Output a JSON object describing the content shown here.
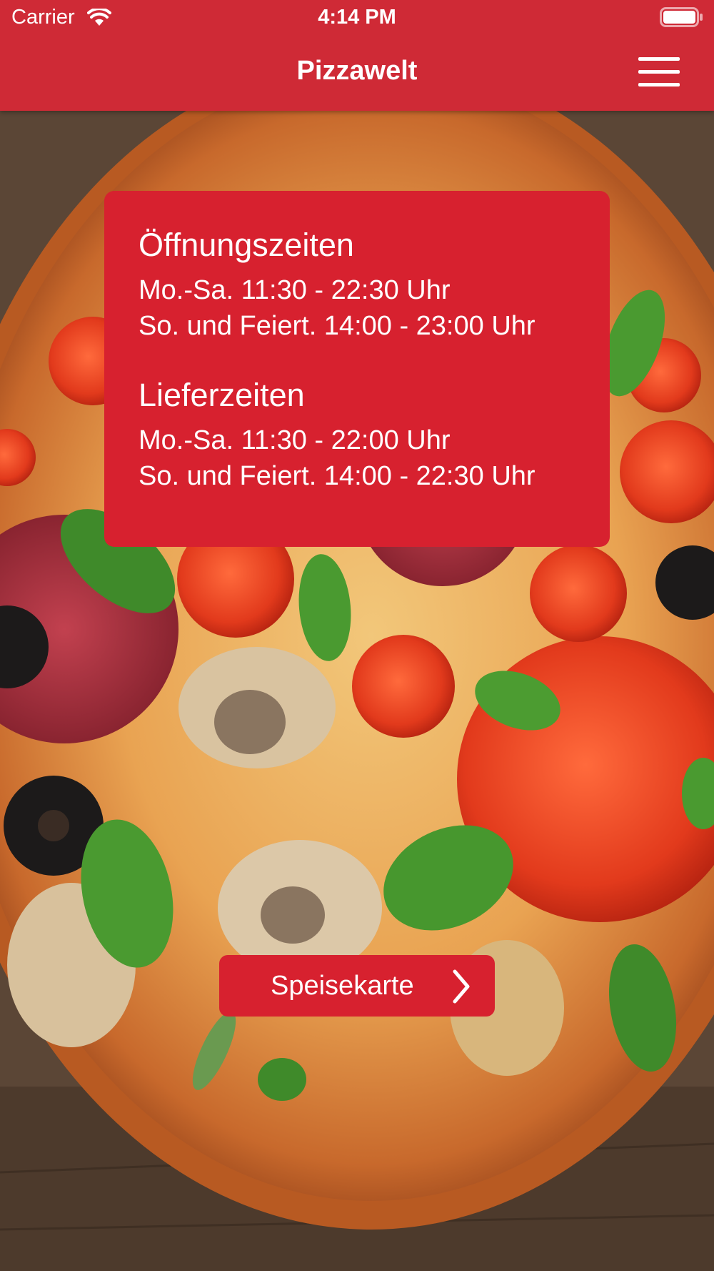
{
  "status_bar": {
    "carrier": "Carrier",
    "time": "4:14 PM"
  },
  "nav": {
    "title": "Pizzawelt",
    "menu_icon": "hamburger-menu-icon"
  },
  "info_card": {
    "opening": {
      "title": "Öffnungszeiten",
      "lines": [
        "Mo.-Sa. 11:30 - 22:30 Uhr",
        "So. und Feiert. 14:00 - 23:00 Uhr"
      ]
    },
    "delivery": {
      "title": "Lieferzeiten",
      "lines": [
        "Mo.-Sa. 11:30 - 22:00 Uhr",
        "So. und Feiert. 14:00 - 22:30 Uhr"
      ]
    }
  },
  "cta": {
    "label": "Speisekarte",
    "icon": "chevron-right-icon"
  },
  "colors": {
    "brand_red": "#d7212f",
    "navbar_red": "#cf2a36",
    "text": "#ffffff"
  }
}
